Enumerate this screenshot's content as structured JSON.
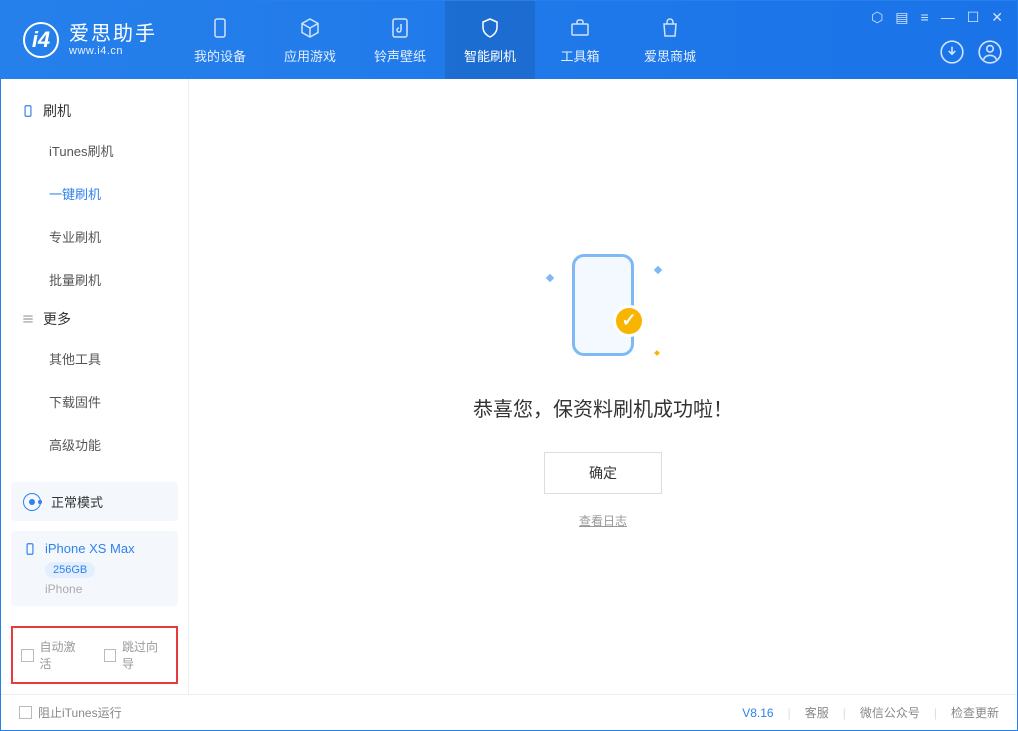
{
  "app": {
    "name": "爱思助手",
    "url": "www.i4.cn"
  },
  "nav": [
    {
      "label": "我的设备"
    },
    {
      "label": "应用游戏"
    },
    {
      "label": "铃声壁纸"
    },
    {
      "label": "智能刷机"
    },
    {
      "label": "工具箱"
    },
    {
      "label": "爱思商城"
    }
  ],
  "sidebar": {
    "group1": "刷机",
    "items1": [
      "iTunes刷机",
      "一键刷机",
      "专业刷机",
      "批量刷机"
    ],
    "group2": "更多",
    "items2": [
      "其他工具",
      "下载固件",
      "高级功能"
    ]
  },
  "mode": {
    "label": "正常模式"
  },
  "device": {
    "name": "iPhone XS Max",
    "capacity": "256GB",
    "type": "iPhone"
  },
  "checks": {
    "auto_activate": "自动激活",
    "skip_guide": "跳过向导"
  },
  "main": {
    "message": "恭喜您，保资料刷机成功啦！",
    "ok": "确定",
    "view_log": "查看日志"
  },
  "footer": {
    "block_itunes": "阻止iTunes运行",
    "version": "V8.16",
    "support": "客服",
    "wechat": "微信公众号",
    "update": "检查更新"
  }
}
